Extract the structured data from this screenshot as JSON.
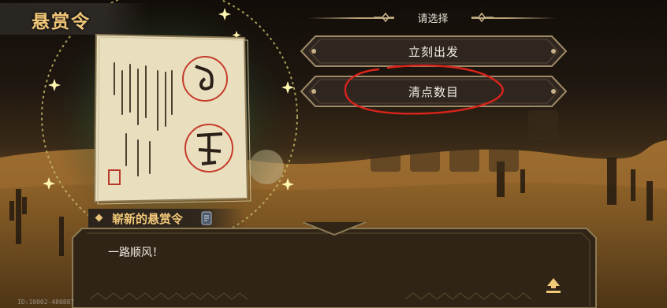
{
  "header": {
    "title": "悬赏令"
  },
  "dialogue_prompt": {
    "text": "请选择"
  },
  "choices": [
    {
      "label": "立刻出发"
    },
    {
      "label": "清点数目"
    }
  ],
  "speaker": {
    "name": "崭新的悬赏令"
  },
  "dialog": {
    "text": "一路顺风！"
  },
  "footer": {
    "id_text": "ID:10002-480887"
  },
  "colors": {
    "title_gold": "#f2c879",
    "annotation_red": "#d8241c",
    "plate_dark": "#2f2620",
    "plate_border": "#9f8a66"
  },
  "icons": [
    "sparkle-icon",
    "ornament-icon",
    "next-arrow-icon",
    "card-badge-icon",
    "seal-icon"
  ]
}
